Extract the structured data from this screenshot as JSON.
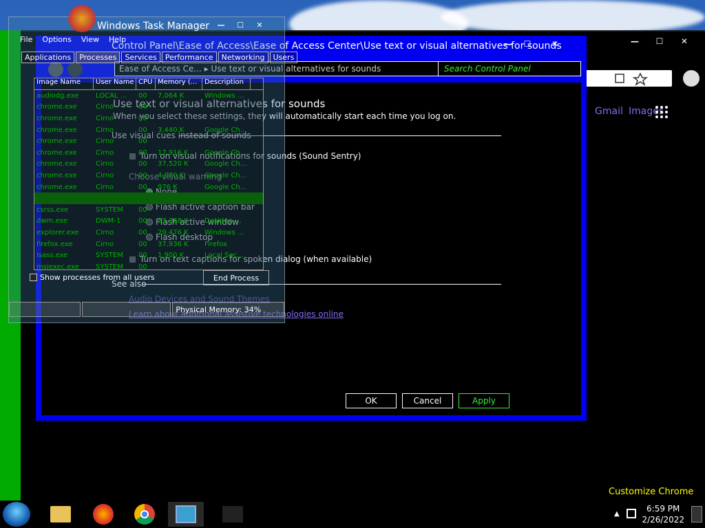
{
  "chrome": {
    "links": [
      "Gmail",
      "Images"
    ],
    "customize_label": "Customize Chrome",
    "window_buttons": [
      "—",
      "☐",
      "✕"
    ]
  },
  "control_panel": {
    "title": "Control Panel\\Ease of Access\\Ease of Access Center\\Use text or visual alternatives for sounds",
    "window_buttons": [
      "—",
      "☐",
      "✕"
    ],
    "breadcrumb": [
      "Ease of Access Ce...",
      "Use text or visual alternatives for sounds"
    ],
    "search_placeholder": "Search Control Panel",
    "heading": "Use text or visual alternatives for sounds",
    "subheading": "When you select these settings, they will automatically start each time you log on.",
    "section_visual_cues": "Use visual cues instead of sounds",
    "checkbox_sound_sentry": "Turn on visual notifications for sounds (Sound Sentry)",
    "choose_warning_label": "Choose visual warning",
    "radio_options": [
      "None",
      "Flash active caption bar",
      "Flash active window",
      "Flash desktop"
    ],
    "checkbox_captions": "Turn on text captions for spoken dialog (when available)",
    "see_also": "See also",
    "see_also_link1": "Audio Devices and Sound Themes",
    "see_also_link2": "Learn about additional assistive technologies online",
    "buttons": {
      "ok": "OK",
      "cancel": "Cancel",
      "apply": "Apply"
    }
  },
  "task_manager": {
    "title": "Windows Task Manager",
    "window_buttons": [
      "—",
      "☐",
      "✕"
    ],
    "menu": [
      "File",
      "Options",
      "View",
      "Help"
    ],
    "tabs": [
      "Applications",
      "Processes",
      "Services",
      "Performance",
      "Networking",
      "Users"
    ],
    "columns": [
      "Image Name",
      "User Name",
      "CPU",
      "Memory (...",
      "Description"
    ],
    "rows": [
      [
        "audiodg.exe",
        "LOCAL ...",
        "00",
        "7,064 K",
        "Windows ..."
      ],
      [
        "chrome.exe",
        "Cirno",
        "00",
        "",
        ""
      ],
      [
        "chrome.exe",
        "Cirno",
        "00",
        "",
        ""
      ],
      [
        "chrome.exe",
        "Cirno",
        "00",
        "3,440 K",
        "Google Ch..."
      ],
      [
        "chrome.exe",
        "Cirno",
        "00",
        "",
        ""
      ],
      [
        "chrome.exe",
        "Cirno",
        "00",
        "17,916 K",
        "Google Ch..."
      ],
      [
        "chrome.exe",
        "Cirno",
        "00",
        "37,520 K",
        "Google Ch..."
      ],
      [
        "chrome.exe",
        "Cirno",
        "00",
        "4,080 K",
        "Google Ch..."
      ],
      [
        "chrome.exe",
        "Cirno",
        "00",
        "976 K",
        "Google Ch..."
      ],
      [
        "",
        "",
        "",
        "",
        ""
      ],
      [
        "csrss.exe",
        "SYSTEM",
        "00",
        "",
        ""
      ],
      [
        "dwm.exe",
        "DWM-1",
        "00",
        "33,368 K",
        "Desktop ..."
      ],
      [
        "explorer.exe",
        "Cirno",
        "00",
        "29,476 K",
        "Windows ..."
      ],
      [
        "firefox.exe",
        "Cirno",
        "00",
        "37,936 K",
        "Firefox"
      ],
      [
        "lsass.exe",
        "SYSTEM",
        "00",
        "1,900 K",
        "Local Sec..."
      ],
      [
        "msiexec.exe",
        "SYSTEM",
        "00",
        "",
        ""
      ]
    ],
    "show_all_label": "Show processes from all users",
    "end_process_label": "End Process",
    "status": [
      "",
      "",
      "Physical Memory: 34%"
    ]
  },
  "taskbar": {
    "time": "6:59 PM",
    "date": "2/26/2022"
  }
}
